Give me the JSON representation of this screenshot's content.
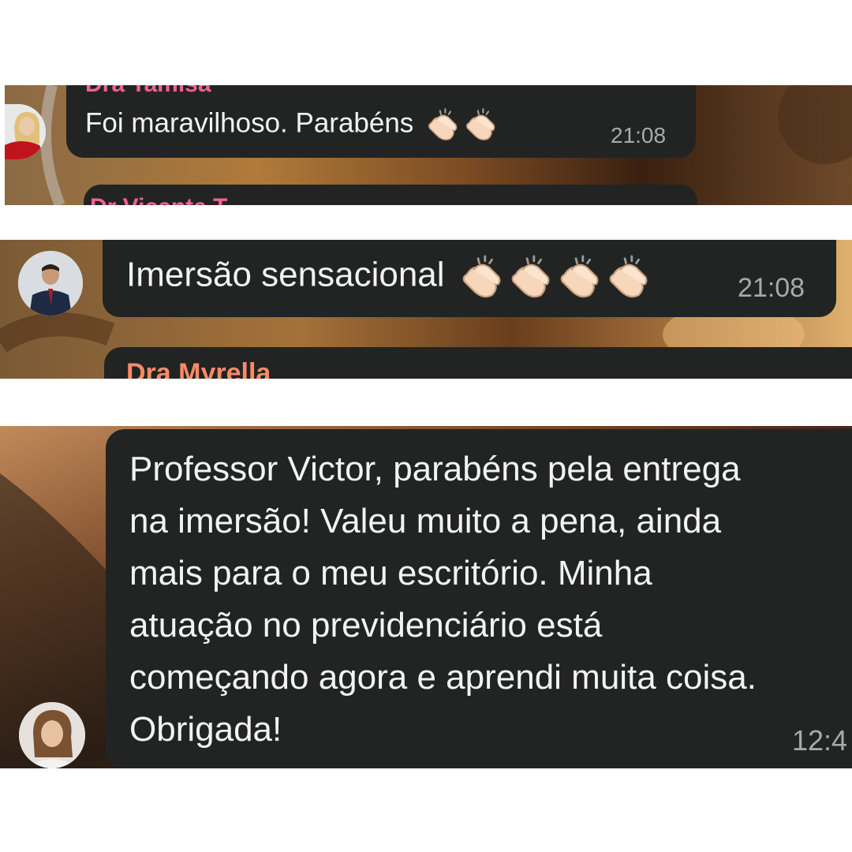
{
  "crop1": {
    "top_name": "Dra Tamisa",
    "message": "Foi maravilhoso. Parabéns",
    "clap_count": 2,
    "time": "21:08",
    "next_name": "Dr Vicente T."
  },
  "crop2": {
    "message": "Imersão sensacional",
    "clap_count": 4,
    "time": "21:08",
    "next_name": "Dra Myrella"
  },
  "crop3": {
    "message": "Professor Victor, parabéns pela entrega\nna imersão! Valeu muito a pena, ainda\nmais para o meu escritório. Minha\natuação no previdenciário está\ncomeçando agora e aprendi muita coisa.\nObrigada!",
    "time": "12:4"
  },
  "colors": {
    "bubble": "#222423",
    "name_pink": "#f06292",
    "name_orange": "#ff8a65",
    "time": "#a9a9a9"
  }
}
